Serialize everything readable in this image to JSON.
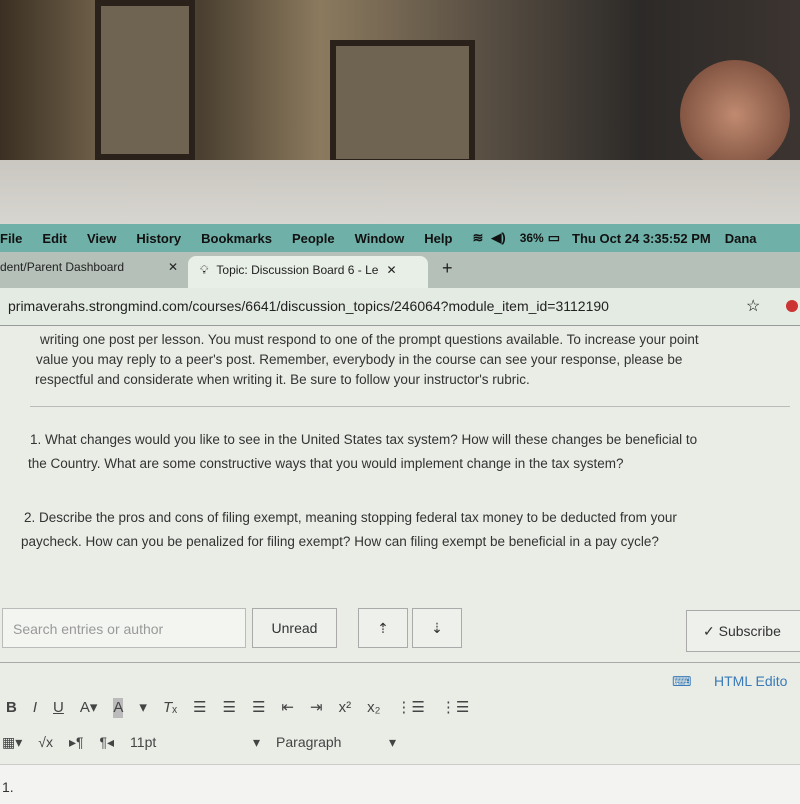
{
  "menubar": {
    "items": [
      "File",
      "Edit",
      "View",
      "History",
      "Bookmarks",
      "People",
      "Window",
      "Help"
    ],
    "battery": "36%",
    "datetime": "Thu Oct 24  3:35:52 PM",
    "user": "Dana"
  },
  "tabs": [
    {
      "label": "dent/Parent Dashboard"
    },
    {
      "label": "Topic: Discussion Board 6 - Le"
    }
  ],
  "address": {
    "url": "primaverahs.strongmind.com/courses/6641/discussion_topics/246064?module_item_id=3112190"
  },
  "intro": [
    "writing one post per lesson. You must respond to one of the prompt questions available. To increase your point",
    "value you may reply to a peer's post. Remember, everybody in the course can see your response, please be",
    "respectful and considerate when writing it. Be sure to follow your instructor's rubric."
  ],
  "questions": [
    [
      "1. What changes would you like to see in the United States tax system? How will these changes be beneficial to",
      "the Country. What are some constructive ways that you would implement change in the tax system?"
    ],
    [
      "2. Describe the pros and cons of filing exempt, meaning stopping federal tax money to be deducted from your",
      "paycheck. How can you be penalized for filing exempt? How can filing exempt be beneficial in a pay cycle?"
    ]
  ],
  "controls": {
    "search_placeholder": "Search entries or author",
    "unread": "Unread",
    "subscribe": "✓ Subscribe"
  },
  "editor": {
    "html_editor": "HTML Edito",
    "font_size": "11pt",
    "block_format": "Paragraph",
    "body": "1."
  }
}
